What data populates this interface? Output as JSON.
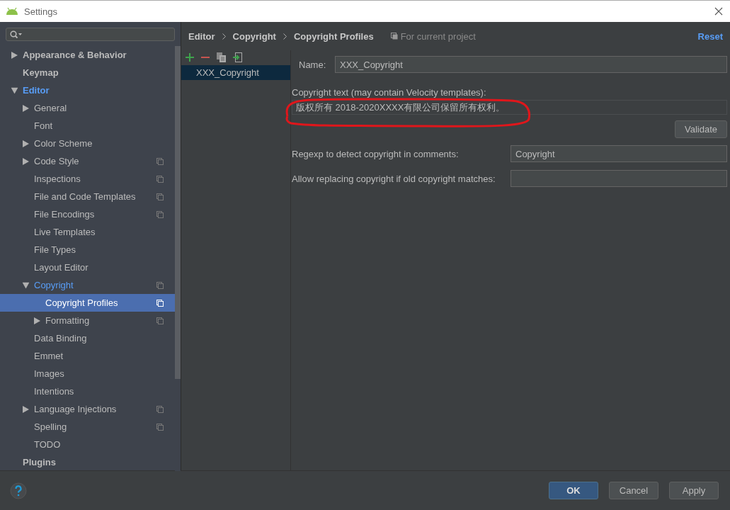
{
  "window": {
    "title": "Settings"
  },
  "sidebar": {
    "tree": [
      {
        "label": "Appearance & Behavior",
        "expanded": false,
        "selected": false,
        "project_scope": false
      },
      {
        "label": "Keymap",
        "selected": false,
        "project_scope": false
      },
      {
        "label": "Editor",
        "expanded": true,
        "selected": false,
        "project_scope": false,
        "children": [
          {
            "label": "General",
            "expanded": false,
            "selected": false,
            "project_scope": false
          },
          {
            "label": "Font",
            "selected": false,
            "project_scope": false
          },
          {
            "label": "Color Scheme",
            "expanded": false,
            "selected": false,
            "project_scope": false
          },
          {
            "label": "Code Style",
            "expanded": false,
            "selected": false,
            "project_scope": true
          },
          {
            "label": "Inspections",
            "selected": false,
            "project_scope": true
          },
          {
            "label": "File and Code Templates",
            "selected": false,
            "project_scope": true
          },
          {
            "label": "File Encodings",
            "selected": false,
            "project_scope": true
          },
          {
            "label": "Live Templates",
            "selected": false,
            "project_scope": false
          },
          {
            "label": "File Types",
            "selected": false,
            "project_scope": false
          },
          {
            "label": "Layout Editor",
            "selected": false,
            "project_scope": false
          },
          {
            "label": "Copyright",
            "expanded": true,
            "selected": false,
            "project_scope": true,
            "children": [
              {
                "label": "Copyright Profiles",
                "selected": true,
                "project_scope": true
              },
              {
                "label": "Formatting",
                "expanded": false,
                "selected": false,
                "project_scope": true
              }
            ]
          },
          {
            "label": "Data Binding",
            "selected": false,
            "project_scope": false
          },
          {
            "label": "Emmet",
            "selected": false,
            "project_scope": false
          },
          {
            "label": "Images",
            "selected": false,
            "project_scope": false
          },
          {
            "label": "Intentions",
            "selected": false,
            "project_scope": false
          },
          {
            "label": "Language Injections",
            "expanded": false,
            "selected": false,
            "project_scope": true
          },
          {
            "label": "Spelling",
            "selected": false,
            "project_scope": true
          },
          {
            "label": "TODO",
            "selected": false,
            "project_scope": false
          }
        ]
      },
      {
        "label": "Plugins",
        "selected": false,
        "project_scope": false
      }
    ]
  },
  "breadcrumb": [
    "Editor",
    "Copyright",
    "Copyright Profiles"
  ],
  "scope_note": "For current project",
  "reset": "Reset",
  "profiles": [
    {
      "label": "XXX_Copyright",
      "selected": true
    }
  ],
  "form": {
    "name_label": "Name:",
    "name_value": "XXX_Copyright",
    "text_label": "Copyright text (may contain Velocity templates):",
    "text_value": "版权所有 2018-2020XXXX有限公司保留所有权利。",
    "validate": "Validate",
    "regexp_label": "Regexp to detect copyright in comments:",
    "regexp_value": "Copyright",
    "replace_label": "Allow replacing copyright if old copyright matches:"
  },
  "buttons": [
    "OK",
    "Cancel",
    "Apply"
  ]
}
